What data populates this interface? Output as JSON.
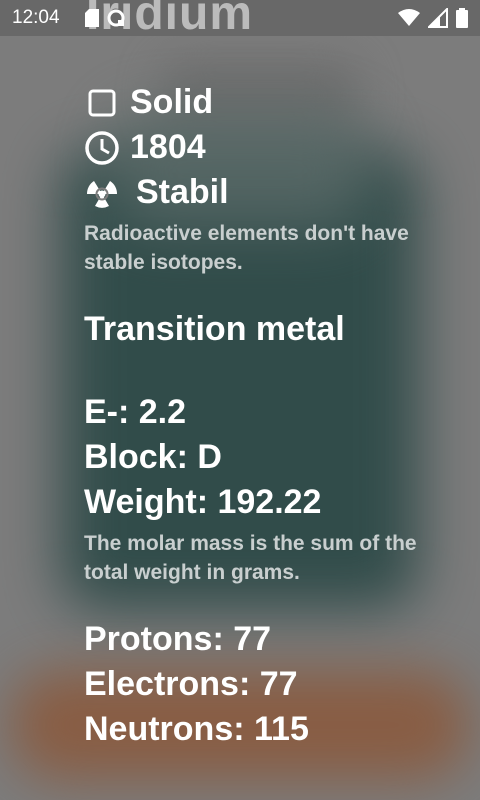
{
  "status_bar": {
    "time": "12:04",
    "left_icons": [
      "sd-card-icon",
      "sync-icon"
    ],
    "right_icons": [
      "wifi-icon",
      "signal-icon",
      "battery-icon"
    ]
  },
  "header": {
    "element_name": "Iridium"
  },
  "properties": {
    "state": "Solid",
    "discovered": "1804",
    "stability": "Stabil",
    "stability_note": "Radioactive elements don't have stable isotopes.",
    "category": "Transition metal",
    "electronegativity": "E-: 2.2",
    "block": "Block: D",
    "weight": "Weight: 192.22",
    "weight_note": "The molar mass is the sum of the total weight in grams.",
    "protons": "Protons: 77",
    "electrons": "Electrons: 77",
    "neutrons": "Neutrons: 115"
  },
  "colors": {
    "background": "#7c7c7c",
    "teal_card": "#2e4a48",
    "orange_glow": "#8a5a3e",
    "note_text": "#c9cfcf"
  }
}
